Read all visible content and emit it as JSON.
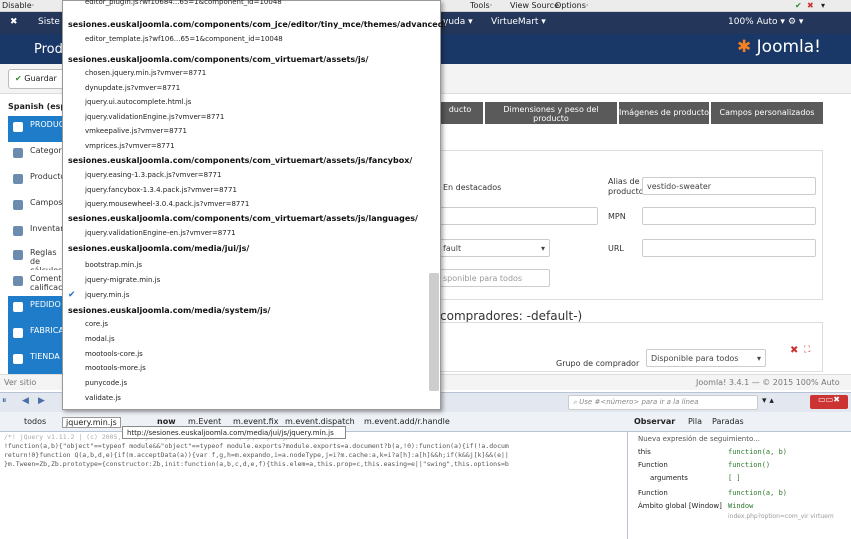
{
  "firefox_bar": {
    "disable": "Disable·",
    "tools": "Tools·",
    "view_source": "View Source·",
    "options": "Options·"
  },
  "joomla_nav": {
    "site": "Siste",
    "help": "yuda ▾",
    "virtuemart": "VirtueMart ▾",
    "zoom": "100% Auto ▾"
  },
  "header": {
    "title": "Prod",
    "logo": "Joomla!"
  },
  "toolbar": {
    "save": "Guardar"
  },
  "language": "Spanish (esp",
  "sidebar": [
    "PRODUC",
    "Categor",
    "Producto",
    "Campos",
    "Inventar",
    "Reglas de cálculos",
    "Comentarios calificac",
    "PEDIDO",
    "FABRICA",
    "TIENDA"
  ],
  "tabs": [
    "ducto",
    "Dimensiones y peso del producto",
    "Imágenes de producto",
    "Campos personalizados"
  ],
  "form": {
    "featured": "En destacados",
    "alias_label": "Alias de producto",
    "alias_value": "vestido-sweater",
    "mpn": "MPN",
    "url": "URL",
    "default_select": "fault",
    "available": "sponible para todos",
    "buyers_heading": "compradores: -default-)",
    "buyer_group": "Grupo de comprador",
    "buyer_group_value": "Disponible para todos"
  },
  "footer": {
    "site": "Ver sitio",
    "version": "Joomla! 3.4.1 — © 2015 100% Auto"
  },
  "firebug": {
    "search_placeholder": "Use #<número> para ir a la línea",
    "all": "todos",
    "script": "jquery.min.js",
    "stack": [
      "now",
      "m.Event",
      "m.event.fix",
      "m.event.dispatch",
      "m.event.add/r.handle"
    ],
    "watch_tabs": [
      "Observar",
      "Pila",
      "Paradas"
    ],
    "tooltip": "http://sesiones.euskaljoomla.com/media/jui/js/jquery.min.js"
  },
  "code_lines": [
    "/*! jQuery v1.11.2 | (c) 2005, 2014 jQuery Foundation, Inc. | jquery.org/license */",
    "!function(a,b){\"object\"==typeof module&&\"object\"==typeof module.exports?module.exports=a.document?b(a,!0):function(a){if(!a.docum",
    "return!0}function Q(a,b,d,e){if(m.acceptData(a)){var f,g,h=m.expando,i=a.nodeType,j=i?m.cache:a,k=i?a[h]:a[h]&&h;if(k&&j[k]&&(e||",
    "}m.Tween=Zb,Zb.prototype={constructor:Zb,init:function(a,b,c,d,e,f){this.elem=a,this.prop=c,this.easing=e||\"swing\",this.options=b"
  ],
  "watch": [
    {
      "name": "Nueva expresión de seguimiento...",
      "value": ""
    },
    {
      "name": "this",
      "value": "function(a, b)"
    },
    {
      "name": "Function",
      "value": "function()"
    },
    {
      "name": "arguments",
      "value": "[ ]"
    },
    {
      "name": "Function",
      "value": "function(a, b)"
    },
    {
      "name": "Ámbito global [Window]",
      "value": "Window"
    }
  ],
  "watch_url": "index.php?option=com_vir  virtuem",
  "dropdown": [
    {
      "type": "item",
      "text": "editor_plugin.js?wf10684...65=1&component_id=10048"
    },
    {
      "type": "head",
      "text": "sesiones.euskaljoomla.com/components/com_jce/editor/tiny_mce/themes/advanced/"
    },
    {
      "type": "item",
      "text": "editor_template.js?wf106...65=1&component_id=10048"
    },
    {
      "type": "head",
      "text": "sesiones.euskaljoomla.com/components/com_virtuemart/assets/js/"
    },
    {
      "type": "item",
      "text": "chosen.jquery.min.js?vmver=8771"
    },
    {
      "type": "item",
      "text": "dynupdate.js?vmver=8771"
    },
    {
      "type": "item",
      "text": "jquery.ui.autocomplete.html.js"
    },
    {
      "type": "item",
      "text": "jquery.validationEngine.js?vmver=8771"
    },
    {
      "type": "item",
      "text": "vmkeepalive.js?vmver=8771"
    },
    {
      "type": "item",
      "text": "vmprices.js?vmver=8771"
    },
    {
      "type": "head",
      "text": "sesiones.euskaljoomla.com/components/com_virtuemart/assets/js/fancybox/"
    },
    {
      "type": "item",
      "text": "jquery.easing-1.3.pack.js?vmver=8771"
    },
    {
      "type": "item",
      "text": "jquery.fancybox-1.3.4.pack.js?vmver=8771"
    },
    {
      "type": "item",
      "text": "jquery.mousewheel-3.0.4.pack.js?vmver=8771"
    },
    {
      "type": "head",
      "text": "sesiones.euskaljoomla.com/components/com_virtuemart/assets/js/languages/"
    },
    {
      "type": "item",
      "text": "jquery.validationEngine-en.js?vmver=8771"
    },
    {
      "type": "head",
      "text": "sesiones.euskaljoomla.com/media/jui/js/"
    },
    {
      "type": "item",
      "text": "bootstrap.min.js"
    },
    {
      "type": "item",
      "text": "jquery-migrate.min.js"
    },
    {
      "type": "item",
      "text": "jquery.min.js",
      "checked": true
    },
    {
      "type": "head",
      "text": "sesiones.euskaljoomla.com/media/system/js/"
    },
    {
      "type": "item",
      "text": "core.js"
    },
    {
      "type": "item",
      "text": "modal.js"
    },
    {
      "type": "item",
      "text": "mootools-core.js"
    },
    {
      "type": "item",
      "text": "mootools-more.js"
    },
    {
      "type": "item",
      "text": "punycode.js"
    },
    {
      "type": "item",
      "text": "validate.js"
    }
  ]
}
